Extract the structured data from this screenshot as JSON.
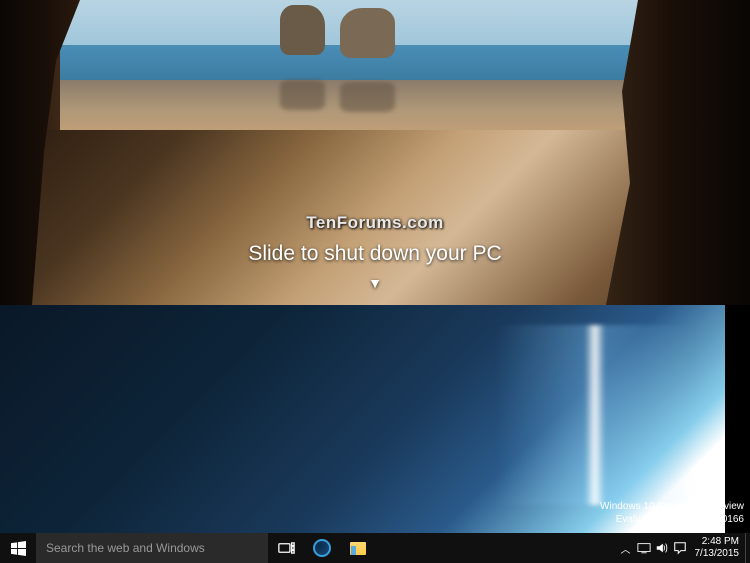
{
  "slide_panel": {
    "brand": "TenForums.com",
    "instruction": "Slide to shut down your PC",
    "arrow": "▼"
  },
  "watermark": {
    "line1": "Windows 10 Pro Insider Preview",
    "line2": "Evaluation copy. Build 10166"
  },
  "taskbar": {
    "search_placeholder": "Search the web and Windows"
  },
  "clock": {
    "time": "2:48 PM",
    "date": "7/13/2015"
  },
  "icons": {
    "start": "start-icon",
    "task_view": "task-view-icon",
    "edge": "edge-icon",
    "explorer": "file-explorer-icon",
    "tray_chevron": "︿",
    "network": "network-icon",
    "volume": "volume-icon",
    "action_center": "action-center-icon"
  }
}
